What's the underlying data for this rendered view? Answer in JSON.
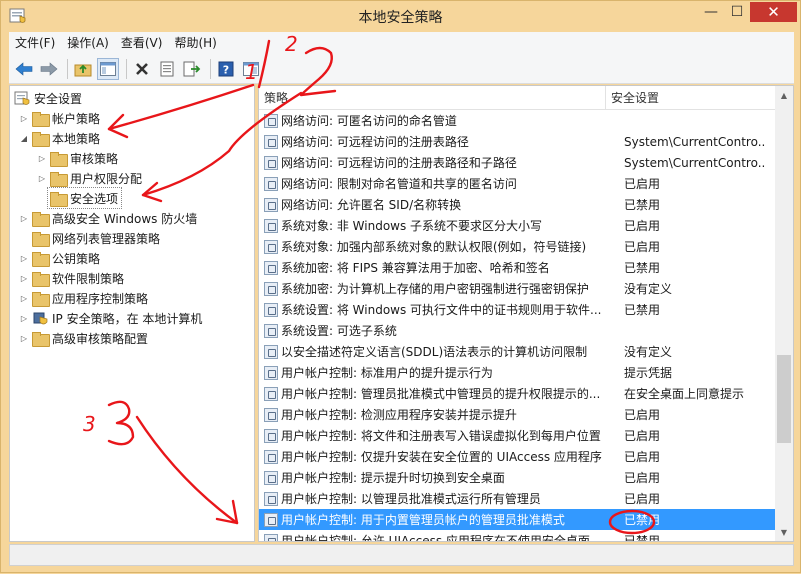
{
  "window": {
    "title": "本地安全策略",
    "min_glyph": "—",
    "max_glyph": "☐",
    "close_glyph": "✕"
  },
  "menu": [
    "文件(F)",
    "操作(A)",
    "查看(V)",
    "帮助(H)"
  ],
  "toolbar_icons": [
    "back-icon",
    "forward-icon",
    "up-folder-icon",
    "show-tree-icon",
    "delete-icon",
    "properties-icon",
    "export-icon",
    "help-icon",
    "console-icon"
  ],
  "tree": {
    "root": "安全设置",
    "items": [
      {
        "label": "帐户策略"
      },
      {
        "label": "本地策略"
      },
      {
        "label": "审核策略"
      },
      {
        "label": "用户权限分配"
      },
      {
        "label": "安全选项"
      },
      {
        "label": "高级安全 Windows 防火墙"
      },
      {
        "label": "网络列表管理器策略"
      },
      {
        "label": "公钥策略"
      },
      {
        "label": "软件限制策略"
      },
      {
        "label": "应用程序控制策略"
      },
      {
        "label": "IP 安全策略，在 本地计算机"
      },
      {
        "label": "高级审核策略配置"
      }
    ]
  },
  "list": {
    "headers": [
      "策略",
      "安全设置"
    ],
    "rows": [
      {
        "policy": "网络访问: 可匿名访问的命名管道",
        "setting": ""
      },
      {
        "policy": "网络访问: 可远程访问的注册表路径",
        "setting": "System\\CurrentContro..."
      },
      {
        "policy": "网络访问: 可远程访问的注册表路径和子路径",
        "setting": "System\\CurrentContro..."
      },
      {
        "policy": "网络访问: 限制对命名管道和共享的匿名访问",
        "setting": "已启用"
      },
      {
        "policy": "网络访问: 允许匿名 SID/名称转换",
        "setting": "已禁用"
      },
      {
        "policy": "系统对象: 非 Windows 子系统不要求区分大小写",
        "setting": "已启用"
      },
      {
        "policy": "系统对象: 加强内部系统对象的默认权限(例如，符号链接)",
        "setting": "已启用"
      },
      {
        "policy": "系统加密: 将 FIPS 兼容算法用于加密、哈希和签名",
        "setting": "已禁用"
      },
      {
        "policy": "系统加密: 为计算机上存储的用户密钥强制进行强密钥保护",
        "setting": "没有定义"
      },
      {
        "policy": "系统设置: 将 Windows 可执行文件中的证书规则用于软件...",
        "setting": "已禁用"
      },
      {
        "policy": "系统设置: 可选子系统",
        "setting": ""
      },
      {
        "policy": "以安全描述符定义语言(SDDL)语法表示的计算机访问限制",
        "setting": "没有定义"
      },
      {
        "policy": "用户帐户控制: 标准用户的提升提示行为",
        "setting": "提示凭据"
      },
      {
        "policy": "用户帐户控制: 管理员批准模式中管理员的提升权限提示的...",
        "setting": "在安全桌面上同意提示"
      },
      {
        "policy": "用户帐户控制: 检测应用程序安装并提示提升",
        "setting": "已启用"
      },
      {
        "policy": "用户帐户控制: 将文件和注册表写入错误虚拟化到每用户位置",
        "setting": "已启用"
      },
      {
        "policy": "用户帐户控制: 仅提升安装在安全位置的 UIAccess 应用程序",
        "setting": "已启用"
      },
      {
        "policy": "用户帐户控制: 提示提升时切换到安全桌面",
        "setting": "已启用"
      },
      {
        "policy": "用户帐户控制: 以管理员批准模式运行所有管理员",
        "setting": "已启用"
      },
      {
        "policy": "用户帐户控制: 用于内置管理员帐户的管理员批准模式",
        "setting": "已禁用"
      },
      {
        "policy": "用户帐户控制: 允许 UIAccess 应用程序在不使用安全桌面...",
        "setting": "已禁用"
      }
    ]
  },
  "annotation_labels": [
    "1",
    "2",
    "3"
  ],
  "colors": {
    "frame": "#f6d69b",
    "selection": "#3399ff",
    "annotation": "#e8161a"
  }
}
